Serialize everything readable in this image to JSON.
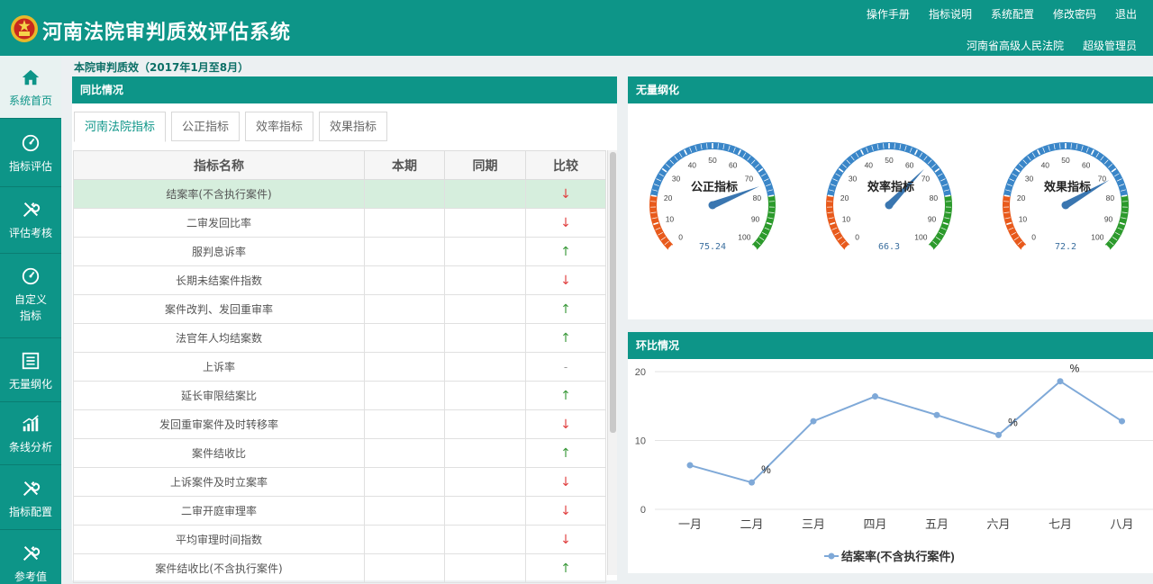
{
  "app": {
    "title": "河南法院审判质效评估系统"
  },
  "top_nav": [
    "操作手册",
    "指标说明",
    "系统配置",
    "修改密码",
    "退出"
  ],
  "top_user": {
    "court": "河南省高级人民法院",
    "role": "超级管理员"
  },
  "sidebar": [
    {
      "label": "系统首页",
      "icon": "home-icon"
    },
    {
      "label": "指标评估",
      "icon": "speedometer-icon"
    },
    {
      "label": "评估考核",
      "icon": "tools-icon"
    },
    {
      "label": "自定义\n指标",
      "icon": "speedometer-icon"
    },
    {
      "label": "无量纲化",
      "icon": "list-icon"
    },
    {
      "label": "条线分析",
      "icon": "bar-chart-icon"
    },
    {
      "label": "指标配置",
      "icon": "tools-icon"
    },
    {
      "label": "参考值",
      "icon": "tools-icon"
    }
  ],
  "breadcrumb": "本院审判质效（2017年1月至8月）",
  "yoy_panel": {
    "title": "同比情况",
    "tabs": [
      "河南法院指标",
      "公正指标",
      "效率指标",
      "效果指标"
    ],
    "columns": [
      "指标名称",
      "本期",
      "同期",
      "比较"
    ],
    "rows": [
      {
        "name": "结案率(不含执行案件)",
        "trend": "↓"
      },
      {
        "name": "二审发回比率",
        "trend": "↓"
      },
      {
        "name": "服判息诉率",
        "trend": "↑"
      },
      {
        "name": "长期未结案件指数",
        "trend": "↓"
      },
      {
        "name": "案件改判、发回重审率",
        "trend": "↑"
      },
      {
        "name": "法官年人均结案数",
        "trend": "↑"
      },
      {
        "name": "上诉率",
        "trend": "-"
      },
      {
        "name": "延长审限结案比",
        "trend": "↑"
      },
      {
        "name": "发回重审案件及时转移率",
        "trend": "↓"
      },
      {
        "name": "案件结收比",
        "trend": "↑"
      },
      {
        "name": "上诉案件及时立案率",
        "trend": "↓"
      },
      {
        "name": "二审开庭审理率",
        "trend": "↓"
      },
      {
        "name": "平均审理时间指数",
        "trend": "↓"
      },
      {
        "name": "案件结收比(不含执行案件)",
        "trend": "↑"
      }
    ]
  },
  "gauge_panel": {
    "title": "无量纲化",
    "gauges": [
      {
        "label": "公正指标",
        "value": 75.24,
        "display": "75.24"
      },
      {
        "label": "效率指标",
        "value": 66.3,
        "display": "66.3"
      },
      {
        "label": "效果指标",
        "value": 72.2,
        "display": "72.2"
      }
    ],
    "scale_labels": [
      "0",
      "10",
      "20",
      "30",
      "40",
      "50",
      "60",
      "70",
      "80",
      "90",
      "100"
    ],
    "colors": {
      "low": "#e85a1c",
      "mid": "#3a86c8",
      "high": "#2c9a2c"
    }
  },
  "mom_panel": {
    "title": "环比情况"
  },
  "chart_data": {
    "type": "line",
    "categories": [
      "一月",
      "二月",
      "三月",
      "四月",
      "五月",
      "六月",
      "七月",
      "八月"
    ],
    "series": [
      {
        "name": "结案率(不含执行案件)",
        "values": [
          6.4,
          3.9,
          12.8,
          16.4,
          13.7,
          10.8,
          18.6,
          12.8
        ],
        "color": "#7fa9d8"
      }
    ],
    "ylim": [
      0,
      20
    ],
    "yticks": [
      "0",
      "10",
      "20"
    ],
    "point_labels": [
      {
        "index": 1,
        "text": "%"
      },
      {
        "index": 5,
        "text": "%"
      },
      {
        "index": 6,
        "text": "%"
      }
    ],
    "legend_position": "bottom-center",
    "grid": true
  }
}
